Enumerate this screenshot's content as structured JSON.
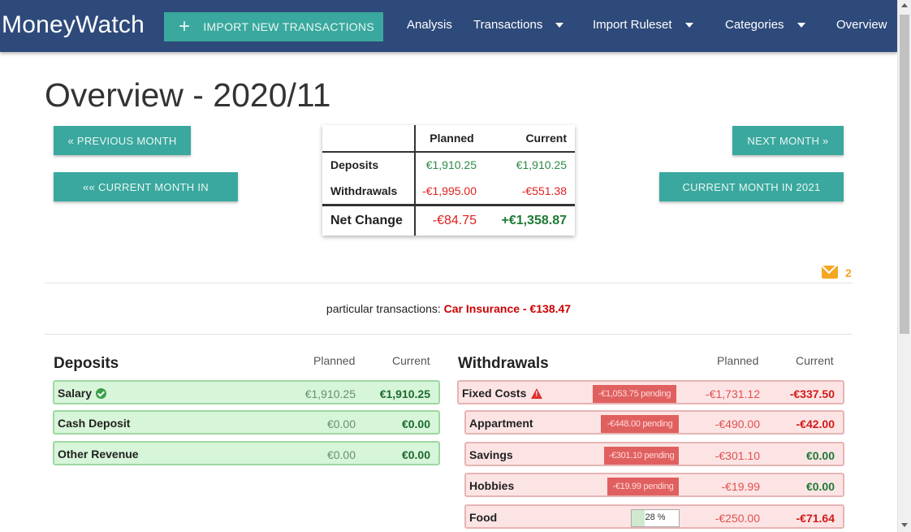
{
  "navbar": {
    "brand": "MoneyWatch",
    "import_label": "Import New Transactions",
    "items": [
      {
        "label": "Analysis",
        "dropdown": false
      },
      {
        "label": "Transactions",
        "dropdown": true
      },
      {
        "label": "Import Ruleset",
        "dropdown": true
      },
      {
        "label": "Categories",
        "dropdown": true
      },
      {
        "label": "Overview",
        "dropdown": false
      }
    ]
  },
  "page": {
    "title": "Overview - 2020/11",
    "prev_month": "« Previous Month",
    "next_month": "Next Month »",
    "current_month_in_prev": "«« Current Month in",
    "current_month_in_next": "Current Month in 2021"
  },
  "summary": {
    "headers": [
      "",
      "Planned",
      "Current"
    ],
    "rows": [
      {
        "label": "Deposits",
        "planned": "€1,910.25",
        "current": "€1,910.25"
      },
      {
        "label": "Withdrawals",
        "planned": "-€1,995.00",
        "current": "-€551.38"
      },
      {
        "label": "Net Change",
        "planned": "-€84.75",
        "current": "+€1,358.87"
      }
    ]
  },
  "notifications": {
    "count": "2"
  },
  "particular": {
    "prefix": "particular transactions:",
    "highlight": "Car Insurance - €138.47"
  },
  "deposits": {
    "title": "Deposits",
    "planned_header": "Planned",
    "current_header": "Current",
    "items": [
      {
        "name": "Salary",
        "planned": "€1,910.25",
        "current": "€1,910.25",
        "icon": "check-icon"
      },
      {
        "name": "Cash Deposit",
        "planned": "€0.00",
        "current": "€0.00"
      },
      {
        "name": "Other Revenue",
        "planned": "€0.00",
        "current": "€0.00"
      }
    ]
  },
  "withdrawals": {
    "title": "Withdrawals",
    "planned_header": "Planned",
    "current_header": "Current",
    "items": [
      {
        "name": "Fixed Costs",
        "pending": "-€1,053.75 pending",
        "planned": "-€1,731.12",
        "current": "-€337.50",
        "icon": "warning-icon"
      },
      {
        "name": "Appartment",
        "pending": "-€448.00 pending",
        "planned": "-€490.00",
        "current": "-€42.00"
      },
      {
        "name": "Savings",
        "pending": "-€301.10 pending",
        "planned": "-€301.10",
        "current": "€0.00"
      },
      {
        "name": "Hobbies",
        "pending": "-€19.99 pending",
        "planned": "-€19.99",
        "current": "€0.00"
      },
      {
        "name": "Food",
        "progress_label": "28 %",
        "progress_fraction": 0.28,
        "planned": "-€250.00",
        "current": "-€71.64"
      }
    ]
  },
  "colors": {
    "navbar": "#2e4a7a",
    "accent": "#3aa89e",
    "positive": "#1d7a35",
    "negative": "#d11a1a",
    "notification": "#f5a623"
  }
}
